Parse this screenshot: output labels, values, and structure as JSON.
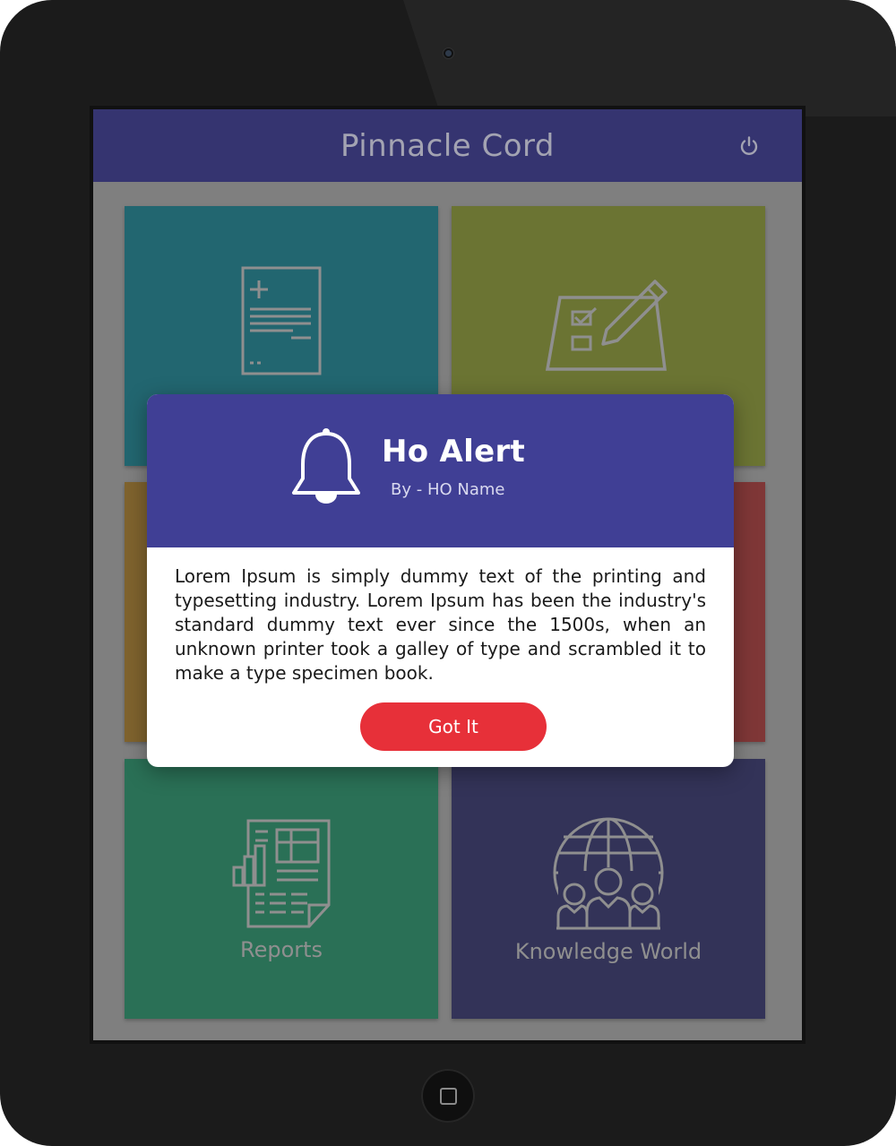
{
  "app": {
    "title": "Pinnacle Cord"
  },
  "tiles": [
    {
      "label": "",
      "icon": "document-add-icon",
      "color": "#226670"
    },
    {
      "label": "",
      "icon": "checklist-pencil-icon",
      "color": "#6b7433"
    },
    {
      "label": "",
      "icon": "",
      "color": "#7f632e"
    },
    {
      "label": "",
      "icon": "",
      "color": "#7f3737"
    },
    {
      "label": "Reports",
      "icon": "report-chart-icon",
      "color": "#2a7056"
    },
    {
      "label": "Knowledge World",
      "icon": "globe-people-icon",
      "color": "#333358"
    }
  ],
  "modal": {
    "title": "Ho Alert",
    "subtitle": "By - HO Name",
    "body": "Lorem Ipsum is simply dummy text of the printing and typesetting industry. Lorem Ipsum has been the industry's standard dummy text ever since the 1500s, when an unknown printer took a galley of type and scrambled it to make a type specimen book.",
    "button_label": "Got It",
    "icon": "bell-icon",
    "header_color": "#403f95",
    "button_color": "#e73039"
  },
  "device": {
    "home_icon": "home-button-icon",
    "power_icon": "power-icon"
  }
}
